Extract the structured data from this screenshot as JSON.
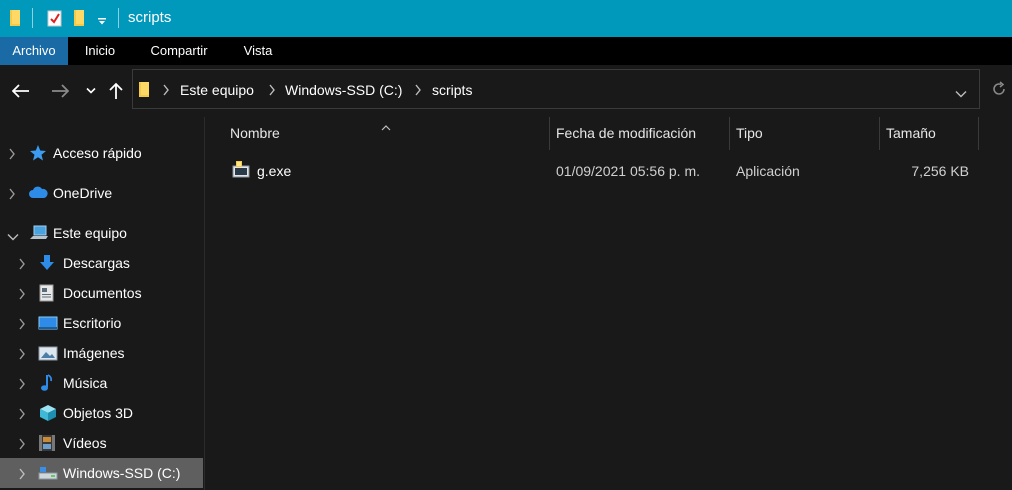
{
  "titlebar": {
    "title": "scripts",
    "icons": [
      "folder-icon",
      "properties-checklist-icon",
      "new-folder-icon",
      "customize-dropdown-icon"
    ],
    "background": "#0099bc"
  },
  "ribbon": {
    "tabs": [
      {
        "label": "Archivo",
        "active": true
      },
      {
        "label": "Inicio",
        "active": false
      },
      {
        "label": "Compartir",
        "active": false
      },
      {
        "label": "Vista",
        "active": false
      }
    ],
    "active_color": "#1a6aa5"
  },
  "address": {
    "crumbs": [
      "Este equipo",
      "Windows-SSD (C:)",
      "scripts"
    ]
  },
  "navpane": {
    "items": [
      {
        "label": "Acceso rápido",
        "icon": "star-icon",
        "expanded": false,
        "indent": 0,
        "selected": false
      },
      {
        "label": "OneDrive",
        "icon": "cloud-icon",
        "expanded": false,
        "indent": 0,
        "selected": false
      },
      {
        "label": "Este equipo",
        "icon": "computer-icon",
        "expanded": true,
        "indent": 0,
        "selected": false
      },
      {
        "label": "Descargas",
        "icon": "download-arrow-icon",
        "expanded": false,
        "indent": 1,
        "selected": false
      },
      {
        "label": "Documentos",
        "icon": "document-icon",
        "expanded": false,
        "indent": 1,
        "selected": false
      },
      {
        "label": "Escritorio",
        "icon": "desktop-icon",
        "expanded": false,
        "indent": 1,
        "selected": false
      },
      {
        "label": "Imágenes",
        "icon": "pictures-icon",
        "expanded": false,
        "indent": 1,
        "selected": false
      },
      {
        "label": "Música",
        "icon": "music-note-icon",
        "expanded": false,
        "indent": 1,
        "selected": false
      },
      {
        "label": "Objetos 3D",
        "icon": "cube-3d-icon",
        "expanded": false,
        "indent": 1,
        "selected": false
      },
      {
        "label": "Vídeos",
        "icon": "film-icon",
        "expanded": false,
        "indent": 1,
        "selected": false
      },
      {
        "label": "Windows-SSD (C:)",
        "icon": "drive-icon",
        "expanded": false,
        "indent": 1,
        "selected": true
      }
    ]
  },
  "filelist": {
    "columns": [
      "Nombre",
      "Fecha de modificación",
      "Tipo",
      "Tamaño"
    ],
    "rows": [
      {
        "name": "g.exe",
        "modified": "01/09/2021 05:56 p. m.",
        "type": "Aplicación",
        "size": "7,256 KB",
        "icon": "application-icon"
      }
    ]
  }
}
